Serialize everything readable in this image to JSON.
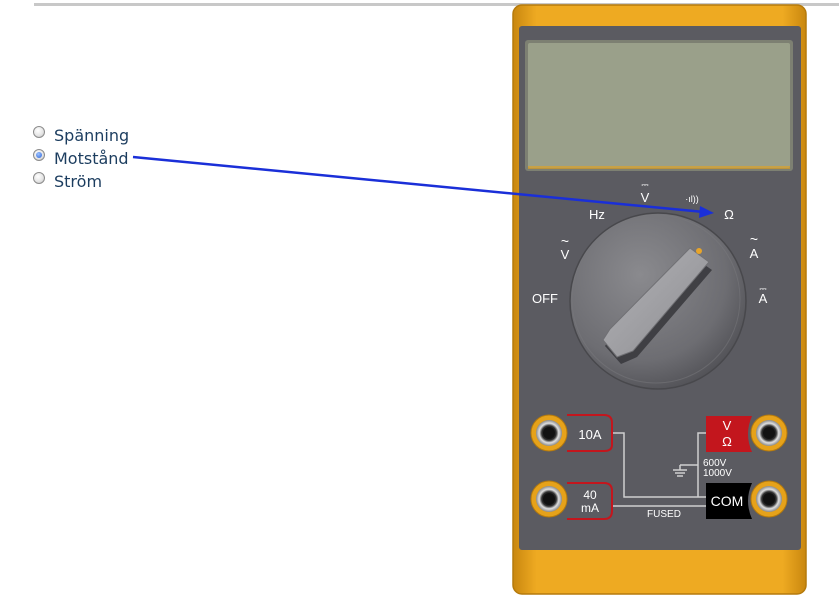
{
  "options": [
    {
      "label": "Spänning",
      "checked": false
    },
    {
      "label": "Motstånd",
      "checked": true
    },
    {
      "label": "Ström",
      "checked": false
    }
  ],
  "dial": {
    "off": "OFF",
    "ac_volt_symbol": "~",
    "ac_volt_unit": "V",
    "hz": "Hz",
    "dc_volt_symbol": "⎓",
    "dc_volt_unit": "V",
    "continuity_symbol": "·ıl))",
    "ohm": "Ω",
    "ac_amp_symbol": "~",
    "ac_amp_unit": "A",
    "dc_amp_symbol": "⎓",
    "dc_amp_unit": "A"
  },
  "jacks": {
    "amp10": "10A",
    "ma40_top": "40",
    "ma40_bottom": "mA",
    "v_top": "V",
    "v_bottom": "Ω",
    "com": "COM",
    "rating_top": "600V",
    "rating_bottom": "1000V",
    "fused": "FUSED"
  },
  "colors": {
    "case": "#e6a21a",
    "face": "#5b5b61",
    "lcd": "#9aa08a",
    "arrow": "#1a2fd8",
    "red": "#c3161d"
  }
}
